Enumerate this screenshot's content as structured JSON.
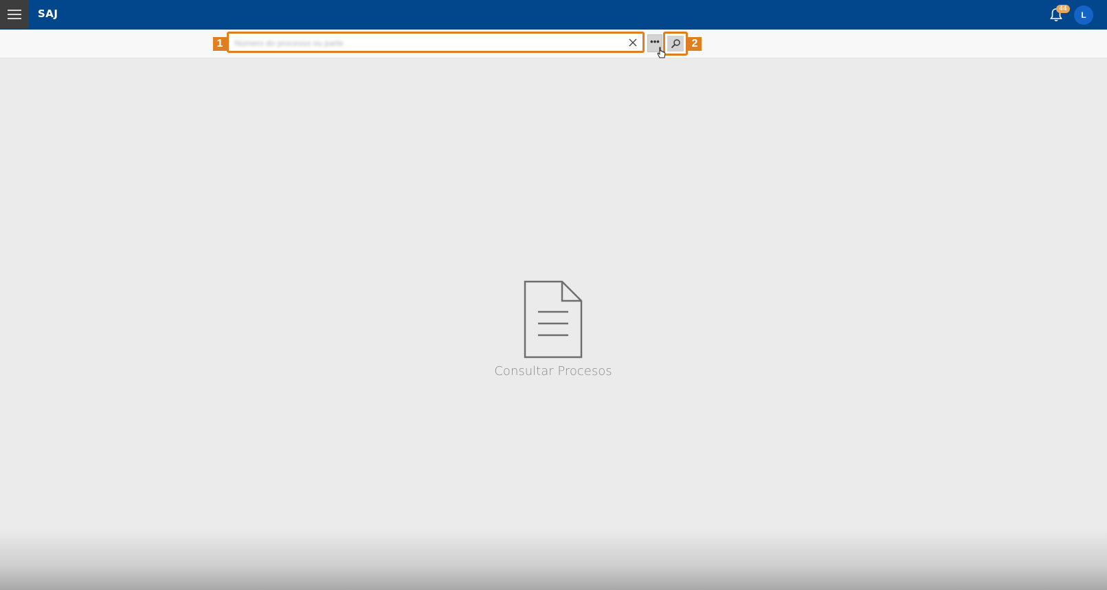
{
  "app": {
    "brand": "SAJ"
  },
  "header": {
    "notifications_count": "44",
    "user_initial": "L",
    "icons": {
      "menu": "hamburger-menu-icon",
      "notifications": "bell-icon"
    }
  },
  "search": {
    "placeholder": "",
    "value_blurred": "Número do processo ou parte",
    "clear_icon": "close-icon",
    "more_label": "•••",
    "search_icon": "magnifier-icon"
  },
  "annotations": {
    "callout_1": "1",
    "callout_2": "2"
  },
  "empty_state": {
    "icon": "document-icon",
    "label": "Consultar Procesos"
  },
  "colors": {
    "topbar": "#02478b",
    "menu_button": "#3d3d3d",
    "accent_callout": "#e07f1f",
    "avatar": "#1464c8",
    "badge": "#e7a85c",
    "background": "#ebebeb"
  }
}
